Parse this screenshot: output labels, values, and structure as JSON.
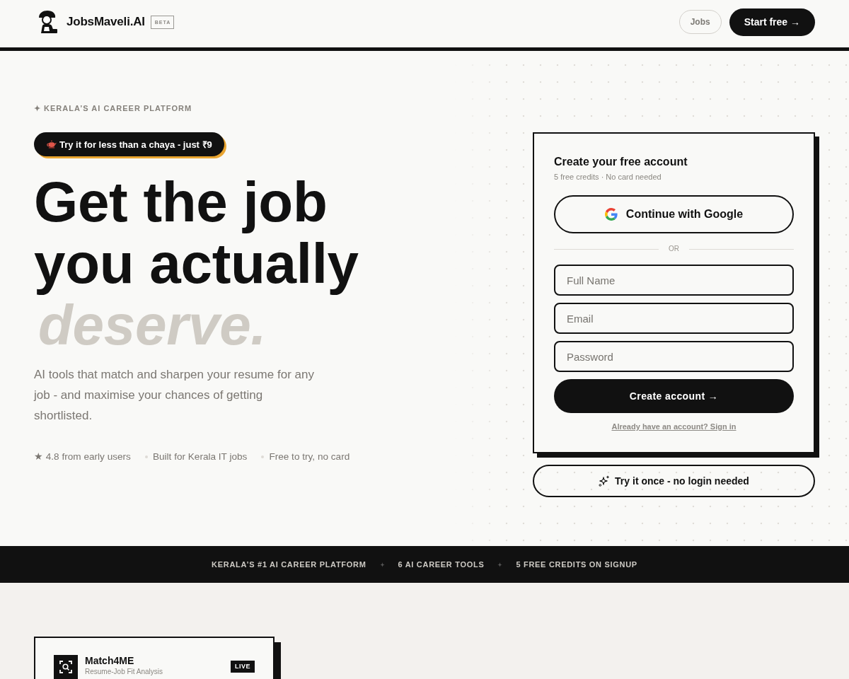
{
  "header": {
    "brand": "JobsMaveli.AI",
    "badge": "BETA",
    "nav": [
      {
        "label": "Jobs",
        "kind": "outline"
      },
      {
        "label": "Start free →",
        "kind": "solid"
      }
    ]
  },
  "hero": {
    "eyebrow": "✦ KERALA’S AI CAREER PLATFORM",
    "promo": "Try it for less than a chaya - just ₹9",
    "headline": [
      {
        "text": "Get the job",
        "kind": "solid"
      },
      {
        "text": "you actually",
        "kind": "solid"
      },
      {
        "text": "deserve.",
        "kind": "faded"
      }
    ],
    "description": "AI tools that match and sharpen your resume for any job - and maximise your chances of getting shortlisted.",
    "highlights": [
      "★ 4.8 from early users",
      "Built for Kerala IT jobs",
      "Free to try, no card"
    ]
  },
  "signup": {
    "title": "Create your free account",
    "subtitle": "5 free credits · No card needed",
    "google_button": "Continue with Google",
    "divider": "OR",
    "fields": [
      {
        "placeholder": "Full Name"
      },
      {
        "placeholder": "Email"
      },
      {
        "placeholder": "Password"
      }
    ],
    "submit": "Create account →",
    "signin_link": "Already have an account? Sign in",
    "guest_button": "Try it once - no login needed"
  },
  "band": {
    "items": [
      "KERALA’S #1 AI CAREER PLATFORM",
      "6 AI CAREER TOOLS",
      "5 FREE CREDITS ON SIGNUP"
    ]
  },
  "tools": [
    {
      "name": "Match4ME",
      "subtitle": "Resume-Job Fit Analysis",
      "badge": "LIVE"
    }
  ]
}
